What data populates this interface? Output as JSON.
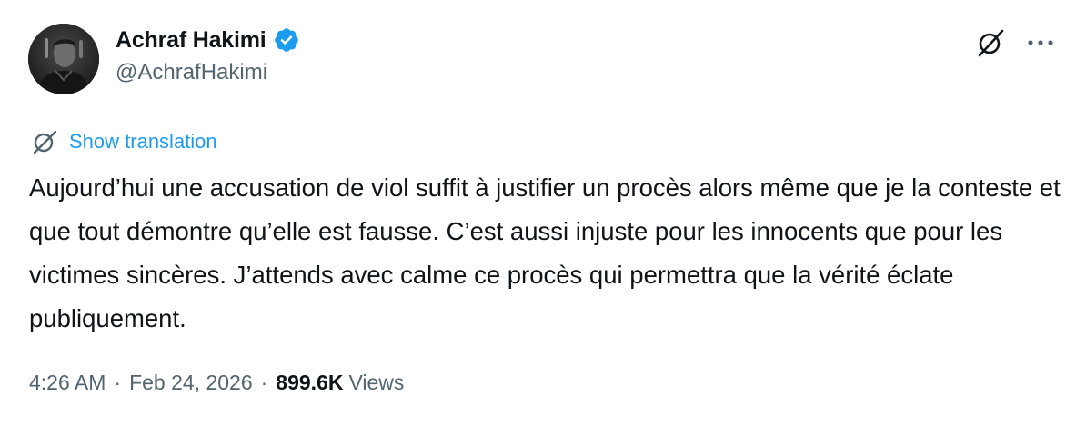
{
  "author": {
    "display_name": "Achraf Hakimi",
    "handle": "@AchrafHakimi",
    "verified": true,
    "verified_color": "#1d9bf0"
  },
  "actions": {
    "grok_icon": "grok-icon",
    "more_icon": "more-icon"
  },
  "translation": {
    "label": "Show translation",
    "icon": "globe-icon",
    "color": "#1d9bf0"
  },
  "tweet": {
    "text": "Aujourd’hui une accusation de viol suffit à justifier un procès alors même que je la conteste et que tout démontre qu’elle est fausse. C’est aussi injuste pour les innocents que pour les victimes sincères. J’attends avec calme ce procès qui permettra que la vérité éclate publiquement."
  },
  "meta": {
    "time": "4:26 AM",
    "separator": "·",
    "date": "Feb 24, 2026",
    "views_count": "899.6K",
    "views_label": "Views"
  }
}
